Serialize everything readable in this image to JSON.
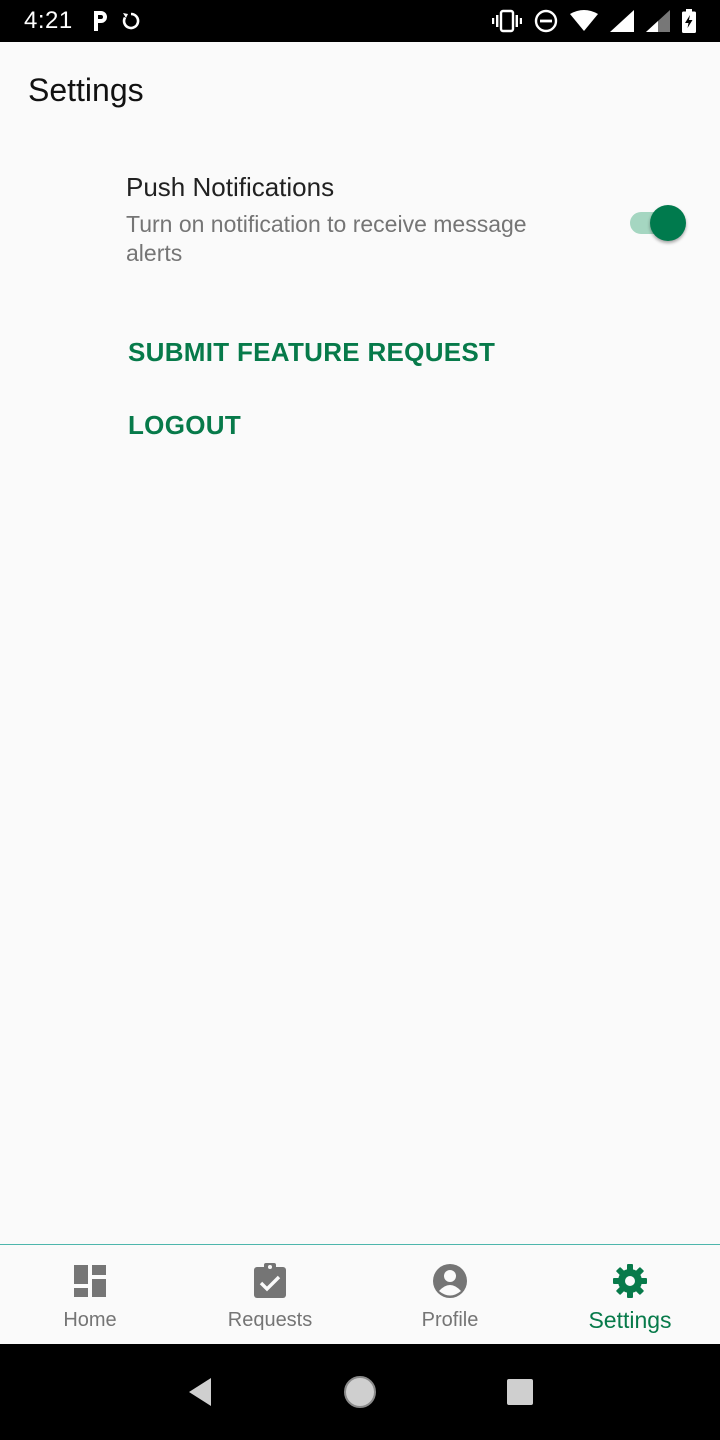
{
  "status_bar": {
    "time": "4:21",
    "left_icons": [
      "parking-icon",
      "sync-icon"
    ],
    "right_icons": [
      "vibrate-icon",
      "do-not-disturb-icon",
      "wifi-icon",
      "signal-icon",
      "signal-icon",
      "battery-charging-icon"
    ]
  },
  "header": {
    "title": "Settings"
  },
  "push_notifications": {
    "title": "Push Notifications",
    "description": "Turn on notification to receive message alerts",
    "enabled": true
  },
  "actions": {
    "feature_request_label": "SUBMIT FEATURE REQUEST",
    "logout_label": "LOGOUT"
  },
  "bottom_nav": {
    "items": [
      {
        "label": "Home",
        "icon": "dashboard-icon",
        "active": false
      },
      {
        "label": "Requests",
        "icon": "assignment-check-icon",
        "active": false
      },
      {
        "label": "Profile",
        "icon": "account-circle-icon",
        "active": false
      },
      {
        "label": "Settings",
        "icon": "gear-icon",
        "active": true
      }
    ]
  },
  "colors": {
    "accent": "#077a4a",
    "toggle_track": "#a5d6c1",
    "inactive": "#757575",
    "background": "#fafafa"
  }
}
